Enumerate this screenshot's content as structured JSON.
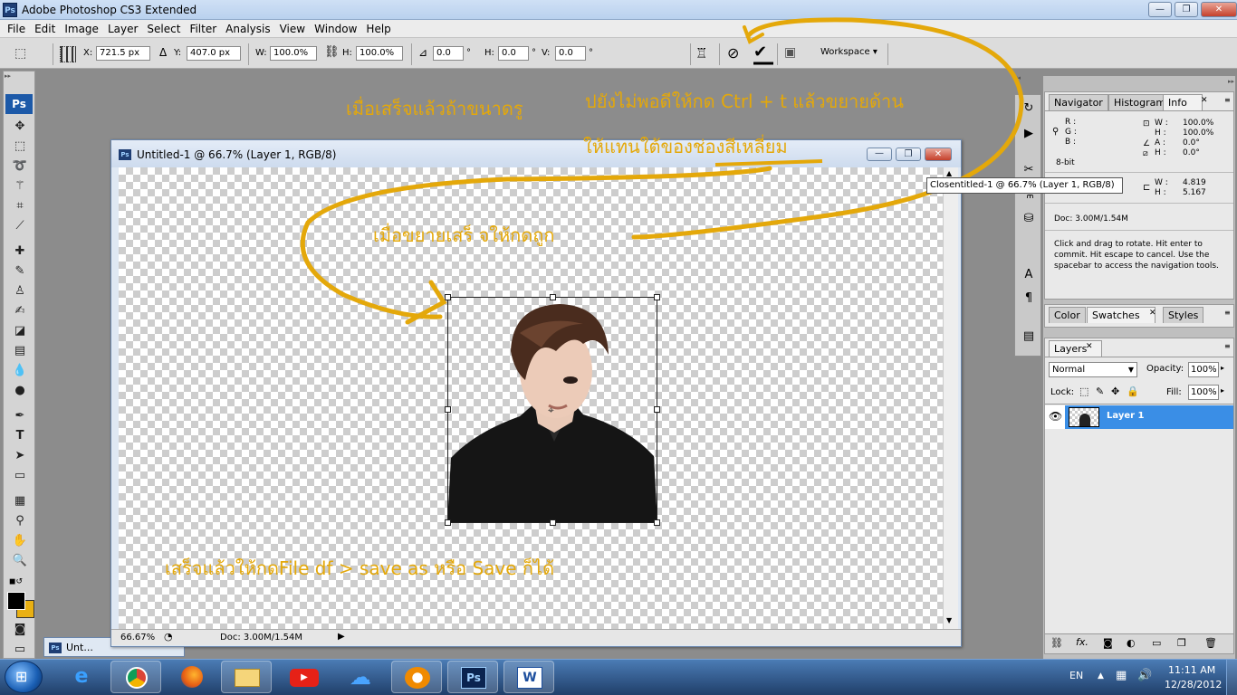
{
  "window": {
    "app_icon": "Ps",
    "title": "Adobe Photoshop CS3 Extended",
    "minimize": "—",
    "maximize": "❐",
    "close": "✕"
  },
  "menu": [
    "File",
    "Edit",
    "Image",
    "Layer",
    "Select",
    "Filter",
    "Analysis",
    "View",
    "Window",
    "Help"
  ],
  "options": {
    "x_label": "X:",
    "x_value": "721.5 px",
    "y_label": "Y:",
    "y_value": "407.0 px",
    "w_label": "W:",
    "w_value": "100.0%",
    "h_label": "H:",
    "h_value": "100.0%",
    "angle_value": "0.0",
    "hskew_label": "H:",
    "hskew_value": "0.0",
    "vskew_label": "V:",
    "vskew_value": "0.0",
    "deg": "°",
    "workspace": "Workspace ▾"
  },
  "toolbox_badge": "Ps",
  "document": {
    "icon": "Ps",
    "title": "Untitled-1 @ 66.7% (Layer 1, RGB/8)",
    "zoom": "66.67%",
    "doc_size": "Doc: 3.00M/1.54M",
    "tooltip": "Close",
    "tooltip_tail": "ntitled-1 @ 66.7% (Layer 1, RGB/8)"
  },
  "minimized_doc": "Unt...",
  "info_panel": {
    "tabs": [
      "Navigator",
      "Histogram",
      "Info"
    ],
    "r": "R :",
    "g": "G :",
    "b": "B :",
    "w_label": "W :",
    "w_value": "100.0%",
    "h_label": "H :",
    "h_value": "100.0%",
    "a_label": "A :",
    "a_value": "0.0°",
    "h2_label": "H :",
    "h2_value": "0.0°",
    "bit": "8-bit",
    "w2_label": "W :",
    "w2_value": "4.819",
    "h3_label": "H :",
    "h3_value": "5.167",
    "doc": "Doc: 3.00M/1.54M",
    "hint": "Click and drag to rotate. Hit enter to commit. Hit escape to cancel. Use the spacebar to access the navigation tools."
  },
  "swatch_panel": {
    "tabs": [
      "Color",
      "Swatches",
      "Styles"
    ]
  },
  "layers_panel": {
    "tab": "Layers",
    "blend_mode": "Normal",
    "opacity_label": "Opacity:",
    "opacity_value": "100%",
    "lock_label": "Lock:",
    "fill_label": "Fill:",
    "fill_value": "100%",
    "layer_name": "Layer 1"
  },
  "annotations": {
    "top_line1_a": "เมื่อเสร็จแล้วถ้าขนาดรู",
    "top_line1_b": "ปยังไม่พอดีให้กด Ctrl + t แล้วขยายด้าน",
    "top_line2": "ให้แทนใต้ของช่องสีเหลี่ยม",
    "middle": "เมื่อขยายเสร็ จให้กดถูก",
    "bottom": "เสร็จแล้วให้กดFile df > save as  หรือ Save ก็ได้"
  },
  "taskbar": {
    "lang": "EN",
    "time": "11:11 AM",
    "date": "12/28/2012",
    "apps": [
      "IE",
      "Chrome",
      "Firefox",
      "Explorer",
      "YouTube",
      "SkyDrive",
      "Messenger",
      "Ps",
      "W"
    ]
  },
  "colors": {
    "annotation": "#e4a80a",
    "selected_layer": "#3a8ee6",
    "photoshop_blue": "#1c59a8"
  }
}
